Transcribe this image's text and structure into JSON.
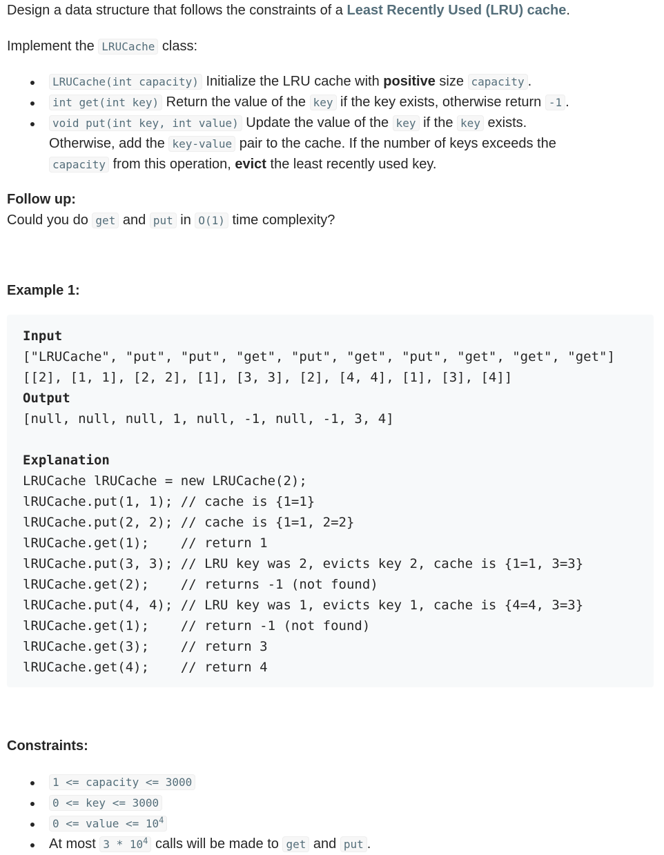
{
  "intro": {
    "prefix": "Design a data structure that follows the constraints of a ",
    "link": "Least Recently Used (LRU) cache",
    "suffix": "."
  },
  "implement": {
    "prefix": "Implement the ",
    "class_name": "LRUCache",
    "suffix": " class:"
  },
  "methods": {
    "m1": {
      "sig": "LRUCache(int capacity)",
      "t1": " Initialize the LRU cache with ",
      "bold": "positive",
      "t2": " size ",
      "code": "capacity",
      "t3": "."
    },
    "m2": {
      "sig": "int get(int key)",
      "t1": " Return the value of the ",
      "code1": "key",
      "t2": " if the key exists, otherwise return ",
      "code2": "-1",
      "t3": "."
    },
    "m3": {
      "sig": "void put(int key, int value)",
      "t1": " Update the value of the ",
      "code1": "key",
      "t2": " if the ",
      "code2": "key",
      "t3": " exists.",
      "l2a": "Otherwise, add the ",
      "code3": "key-value",
      "l2b": " pair to the cache. If the number of keys exceeds the",
      "code4": "capacity",
      "l3a": " from this operation, ",
      "bold": "evict",
      "l3b": " the least recently used key."
    }
  },
  "follow_up": {
    "heading": "Follow up:",
    "a": "Could you do ",
    "get": "get",
    "b": " and ",
    "put": "put",
    "c": " in ",
    "o1": "O(1)",
    "d": " time complexity?"
  },
  "example": {
    "heading": "Example 1:",
    "input_label": "Input",
    "input_line1": "[\"LRUCache\", \"put\", \"put\", \"get\", \"put\", \"get\", \"put\", \"get\", \"get\", \"get\"]",
    "input_line2": "[[2], [1, 1], [2, 2], [1], [3, 3], [2], [4, 4], [1], [3], [4]]",
    "output_label": "Output",
    "output_line": "[null, null, null, 1, null, -1, null, -1, 3, 4]",
    "explanation_label": "Explanation",
    "explanation_lines": [
      "LRUCache lRUCache = new LRUCache(2);",
      "lRUCache.put(1, 1); // cache is {1=1}",
      "lRUCache.put(2, 2); // cache is {1=1, 2=2}",
      "lRUCache.get(1);    // return 1",
      "lRUCache.put(3, 3); // LRU key was 2, evicts key 2, cache is {1=1, 3=3}",
      "lRUCache.get(2);    // returns -1 (not found)",
      "lRUCache.put(4, 4); // LRU key was 1, evicts key 1, cache is {4=4, 3=3}",
      "lRUCache.get(1);    // return -1 (not found)",
      "lRUCache.get(3);    // return 3",
      "lRUCache.get(4);    // return 4"
    ]
  },
  "constraints": {
    "heading": "Constraints:",
    "c1": "1 <= capacity <= 3000",
    "c2": "0 <= key <= 3000",
    "c3_base": "0 <= value <= 10",
    "c3_exp": "4",
    "c4_a": "At most ",
    "c4_code_base": "3 * 10",
    "c4_code_exp": "4",
    "c4_b": " calls will be made to ",
    "c4_get": "get",
    "c4_c": " and ",
    "c4_put": "put",
    "c4_d": "."
  }
}
